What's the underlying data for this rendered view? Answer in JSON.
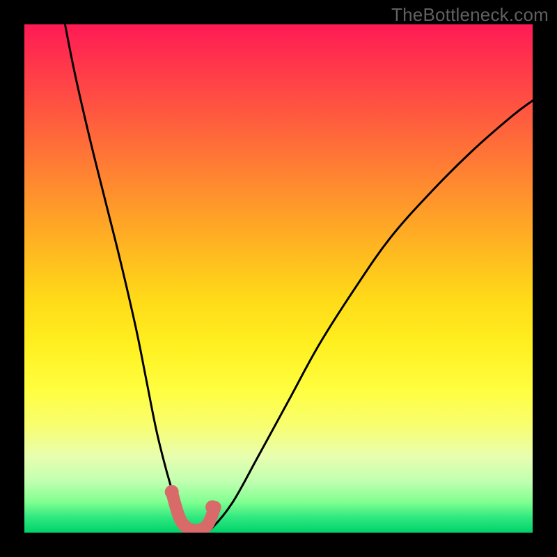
{
  "watermark": "TheBottleneck.com",
  "chart_data": {
    "type": "line",
    "title": "",
    "xlabel": "",
    "ylabel": "",
    "xlim": [
      0,
      100
    ],
    "ylim": [
      0,
      100
    ],
    "grid": false,
    "series": [
      {
        "name": "curve",
        "x": [
          8,
          10,
          13,
          16,
          19,
          22,
          24,
          26,
          28,
          29.5,
          31,
          33,
          35,
          37,
          41,
          46,
          52,
          58,
          65,
          72,
          80,
          88,
          96,
          100
        ],
        "y": [
          100,
          90,
          77,
          65,
          53,
          40,
          30,
          20,
          12,
          7,
          3,
          1,
          0,
          1,
          6,
          15,
          26,
          37,
          48,
          58,
          67,
          75,
          82,
          85
        ]
      }
    ],
    "markers": [
      {
        "x": 29,
        "y": 8,
        "name": "left-endpoint"
      },
      {
        "x": 37,
        "y": 5,
        "name": "right-endpoint"
      }
    ],
    "marker_segment": {
      "x": [
        29,
        30.5,
        32,
        34,
        36,
        37.5
      ],
      "y": [
        8,
        3,
        1,
        0.5,
        1.5,
        5
      ]
    },
    "colors": {
      "gradient_top": "#ff1a55",
      "gradient_bottom": "#00d26a",
      "curve": "#000000",
      "marker": "#d96a6a"
    }
  }
}
